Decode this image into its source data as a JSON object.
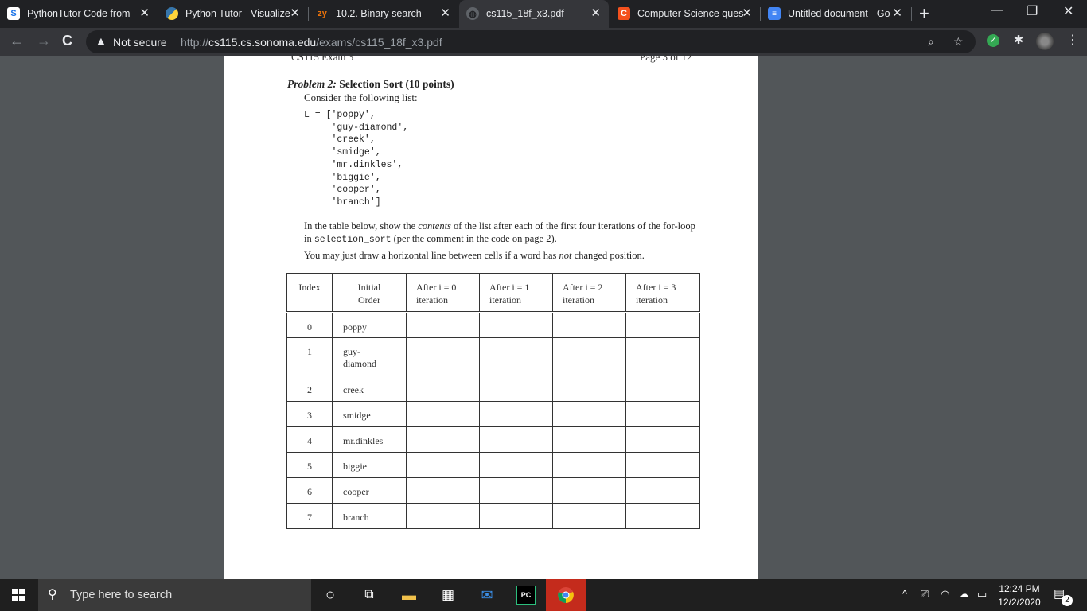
{
  "tabs": [
    {
      "title": "PythonTutor Code from",
      "favicon": "S",
      "favicon_color": "#1a73e8",
      "active": false
    },
    {
      "title": "Python Tutor - Visualize",
      "favicon": "py",
      "favicon_color": "#3776ab",
      "active": false
    },
    {
      "title": "10.2. Binary search",
      "favicon": "zy",
      "favicon_color": "#e8710a",
      "active": false
    },
    {
      "title": "cs115_18f_x3.pdf",
      "favicon": "globe",
      "favicon_color": "#9aa0a6",
      "active": true
    },
    {
      "title": "Computer Science ques",
      "favicon": "C",
      "favicon_color": "#f4511e",
      "active": false
    },
    {
      "title": "Untitled document - Go",
      "favicon": "doc",
      "favicon_color": "#4285f4",
      "active": false
    }
  ],
  "address_bar": {
    "security_label": "Not secure",
    "url_prefix": "http://",
    "url_host": "cs115.cs.sonoma.edu",
    "url_path": "/exams/cs115_18f_x3.pdf"
  },
  "pdf": {
    "header_left": "CS115 Exam 3",
    "header_right": "Page 3 of 12",
    "problem_label": "Problem 2:",
    "problem_title": "Selection Sort (10 points)",
    "consider_text": "Consider the following list:",
    "code_lines": [
      "L = ['poppy',",
      "     'guy-diamond',",
      "     'creek',",
      "     'smidge',",
      "     'mr.dinkles',",
      "     'biggie',",
      "     'cooper',",
      "     'branch']"
    ],
    "instr_1a": "In the table below, show the ",
    "instr_1b": "contents",
    "instr_1c": " of the list after each of the first four iterations of the for-loop in ",
    "instr_1d": "selection_sort",
    "instr_1e": " (per the comment in the code on page 2).",
    "instr_2a": "You may just draw a horizontal line between cells if a word has ",
    "instr_2b": "not",
    "instr_2c": " changed position.",
    "table_headers": [
      [
        "Index",
        ""
      ],
      [
        "Initial",
        "Order"
      ],
      [
        "After i = 0",
        "iteration"
      ],
      [
        "After i = 1",
        "iteration"
      ],
      [
        "After i = 2",
        "iteration"
      ],
      [
        "After i = 3",
        "iteration"
      ]
    ],
    "rows": [
      {
        "index": "0",
        "name": "poppy"
      },
      {
        "index": "1",
        "name": "guy-",
        "name2": "diamond"
      },
      {
        "index": "2",
        "name": "creek"
      },
      {
        "index": "3",
        "name": "smidge"
      },
      {
        "index": "4",
        "name": "mr.dinkles"
      },
      {
        "index": "5",
        "name": "biggie"
      },
      {
        "index": "6",
        "name": "cooper"
      },
      {
        "index": "7",
        "name": "branch"
      }
    ]
  },
  "taskbar": {
    "search_placeholder": "Type here to search",
    "time": "12:24 PM",
    "date": "12/2/2020",
    "notification_count": "2"
  }
}
